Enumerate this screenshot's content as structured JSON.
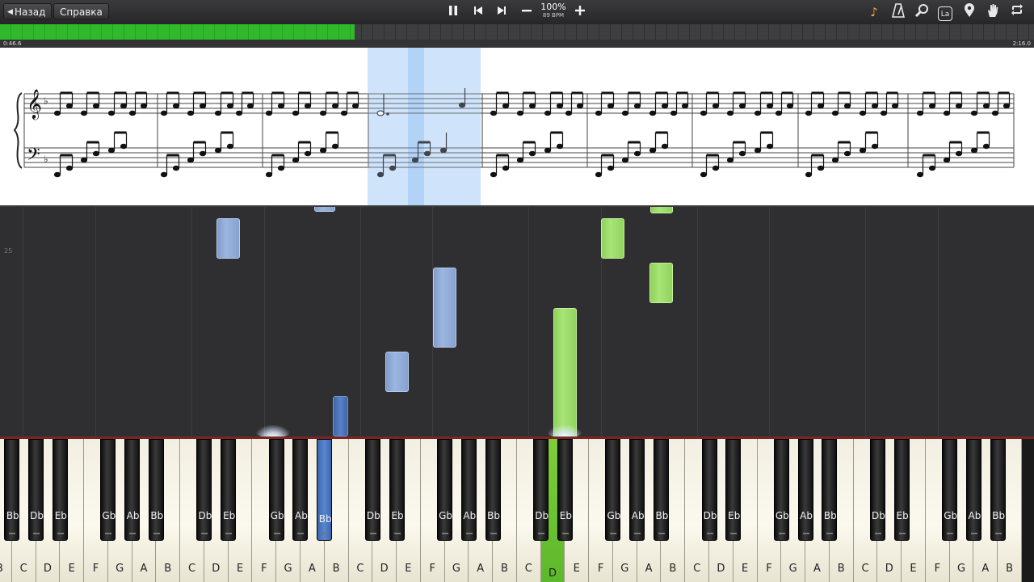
{
  "toolbar": {
    "back_label": "Назад",
    "help_label": "Справка",
    "speed_percent": "100%",
    "tempo": "89 BPM",
    "icons": [
      "pause-icon",
      "skip-back-icon",
      "skip-forward-icon",
      "minus-icon",
      "plus-icon",
      "note-icon",
      "metronome-icon",
      "magnifier-icon",
      "note-label-icon",
      "location-pin-icon",
      "hand-icon",
      "loop-icon"
    ],
    "note_label_glyph": "La"
  },
  "progress": {
    "current_time": "0:46.6",
    "total_time": "2:16.0",
    "fraction_played": 0.343,
    "color": "#2fb92b"
  },
  "roll": {
    "measure_number": "25"
  },
  "keyboard": {
    "white_keys": [
      "B",
      "C",
      "D",
      "E",
      "F",
      "G",
      "A",
      "B",
      "C",
      "D",
      "E",
      "F",
      "G",
      "A",
      "B",
      "C",
      "D",
      "E",
      "F",
      "G",
      "A",
      "B",
      "C",
      "D",
      "E",
      "F",
      "G",
      "A",
      "B",
      "C",
      "D",
      "E",
      "F",
      "G",
      "A",
      "B",
      "C",
      "D",
      "E",
      "F",
      "G",
      "A",
      "B"
    ],
    "black_keys": [
      "Bb",
      "Db",
      "Eb",
      "Gb",
      "Ab",
      "Bb",
      "Db",
      "Eb",
      "Gb",
      "Ab",
      "Bb",
      "Db",
      "Eb",
      "Gb",
      "Ab",
      "Bb",
      "Db",
      "Eb",
      "Gb",
      "Ab",
      "Bb",
      "Db",
      "Eb",
      "Gb",
      "Ab",
      "Bb",
      "Db",
      "Eb",
      "Gb",
      "Ab",
      "Bb",
      "Db",
      "Eb",
      "Gb",
      "Ab",
      "Bb"
    ],
    "pressed_white_index": 23,
    "pressed_black_index": 10,
    "left_hand_color": "#5a82c4",
    "right_hand_color": "#8ed15a"
  }
}
